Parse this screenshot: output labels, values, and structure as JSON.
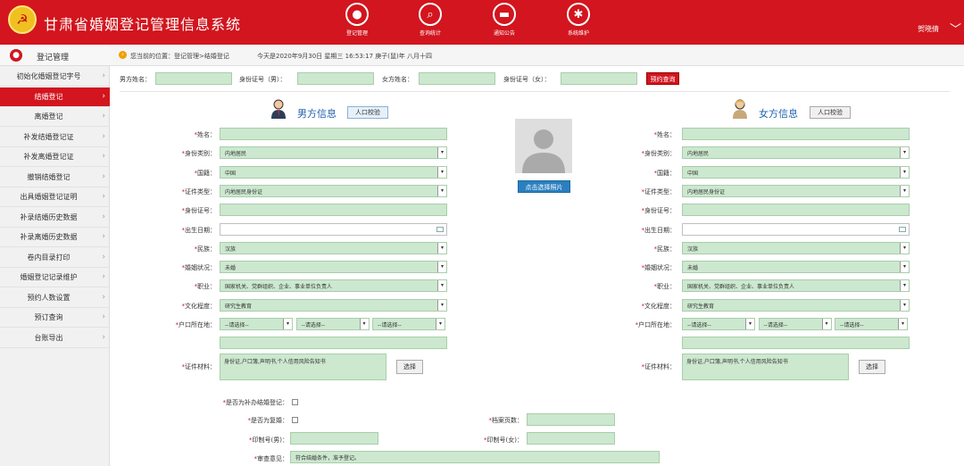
{
  "app": {
    "title": "甘肃省婚姻登记管理信息系统",
    "emblem_glyph": "☭"
  },
  "nav": [
    {
      "label": "登记管理",
      "icon": "person-icon",
      "glyph": "●"
    },
    {
      "label": "查询统计",
      "icon": "search-icon",
      "glyph": "⌕"
    },
    {
      "label": "通知公告",
      "icon": "chat-icon",
      "glyph": "▬"
    },
    {
      "label": "系统维护",
      "icon": "gear-icon",
      "glyph": "✱"
    }
  ],
  "user": {
    "name": "贺晓倩",
    "caret": "﹀"
  },
  "sidebar": {
    "header": "登记管理",
    "header_glyph": "●",
    "chevron": "›",
    "items": [
      {
        "label": "初始化婚姻登记字号"
      },
      {
        "label": "结婚登记",
        "active": true
      },
      {
        "label": "离婚登记"
      },
      {
        "label": "补发结婚登记证"
      },
      {
        "label": "补发离婚登记证"
      },
      {
        "label": "撤销结婚登记"
      },
      {
        "label": "出具婚姻登记证明"
      },
      {
        "label": "补录结婚历史数据"
      },
      {
        "label": "补录离婚历史数据"
      },
      {
        "label": "卷内目录打印"
      },
      {
        "label": "婚姻登记记录维护"
      },
      {
        "label": "预约人数设置"
      },
      {
        "label": "预订查询"
      },
      {
        "label": "台账导出"
      }
    ]
  },
  "breadcrumb": {
    "icon_glyph": "›",
    "location": "您当前的位置：登记管理>结婚登记",
    "today": "今天是2020年9月30日 星期三 16:53:17 庚子(鼠)年 八月十四"
  },
  "search": {
    "male_name_label": "男方姓名：",
    "male_id_label": "身份证号（男）：",
    "female_name_label": "女方姓名：",
    "female_id_label": "身份证号（女）：",
    "button": "预约查询"
  },
  "male": {
    "title": "男方信息",
    "check_button": "人口校验"
  },
  "female": {
    "title": "女方信息",
    "check_button": "人口校验"
  },
  "photo": {
    "button": "点击选择照片"
  },
  "fields": {
    "name_m": "姓名：",
    "name_f": "姓名：",
    "idtype": "身份类别：",
    "nation": "国籍：",
    "certtype": "证件类型：",
    "idno_m": "身份证号：",
    "idno_f": "身份证号：",
    "birth_m": "出生日期：",
    "birth_f": "出生日期：",
    "ethnic": "民族：",
    "marital": "婚姻状况：",
    "job_m": "职业：",
    "job_f": "职业：",
    "edu": "文化程度：",
    "hukou": "户口所在地：",
    "material_m": "证件材料：",
    "material_f": "证件材料："
  },
  "values": {
    "idtype": "内地居民",
    "nation": "中国",
    "certtype": "内地居民身份证",
    "ethnic": "汉族",
    "marital": "未婚",
    "job": "国家机关、党群组织、企业、事业单位负责人",
    "edu": "研究生教育",
    "hukou_placeholder": "--请选择--",
    "material": "身份证,户口簿,声明书,个人信用风险告知书",
    "material_button": "选择",
    "dropdown_glyph": "▾"
  },
  "bottom": {
    "supplement_label": "是否为补办结婚登记：",
    "remarry_label": "是否为复婚：",
    "archive_pages_label": "档案页数：",
    "print_m_label": "印制号(男)：",
    "print_f_label": "印制号(女)：",
    "review_label": "审查意见：",
    "review_value": "符合结婚条件，准予登记。"
  },
  "required_mark": "*"
}
